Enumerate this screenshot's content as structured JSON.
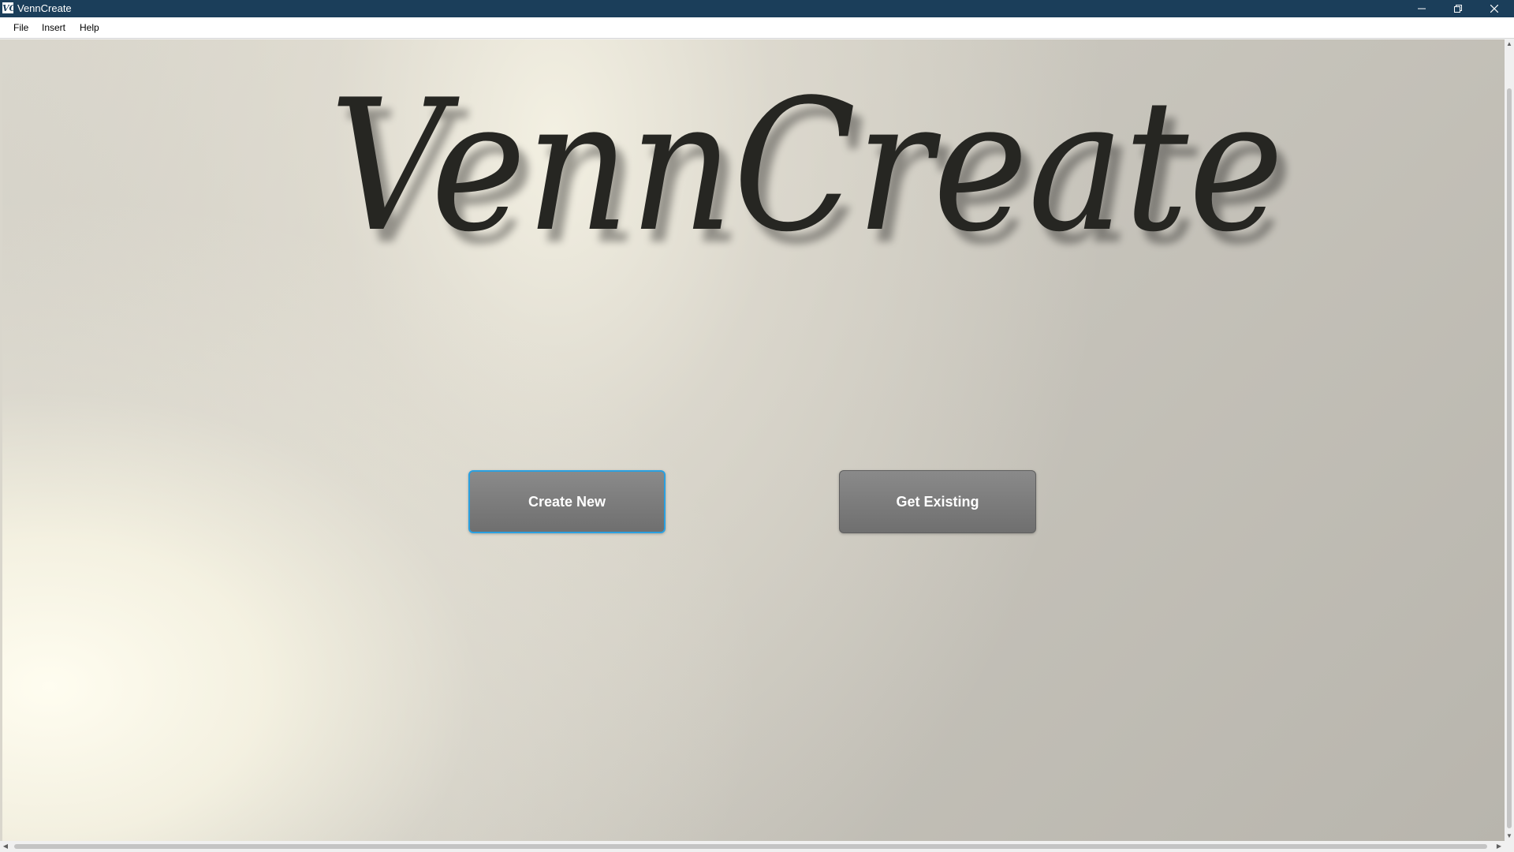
{
  "window": {
    "title": "VennCreate",
    "icon_text": "VC",
    "title_bar_color": "#1b3e5a",
    "controls": {
      "minimize_icon": "minimize-icon",
      "restore_icon": "restore-icon",
      "close_icon": "close-icon"
    }
  },
  "menu": {
    "items": [
      {
        "label": "File"
      },
      {
        "label": "Insert"
      },
      {
        "label": "Help"
      }
    ]
  },
  "main": {
    "logo_text": "VennCreate",
    "buttons": {
      "create_new": "Create New",
      "get_existing": "Get Existing"
    },
    "focus_color": "#2aa0e0",
    "button_color": "#7a7a7a"
  },
  "scrollbars": {
    "vertical": {
      "up_icon": "arrow-up-icon",
      "down_icon": "arrow-down-icon"
    },
    "horizontal": {
      "left_icon": "arrow-left-icon",
      "right_icon": "arrow-right-icon"
    }
  }
}
